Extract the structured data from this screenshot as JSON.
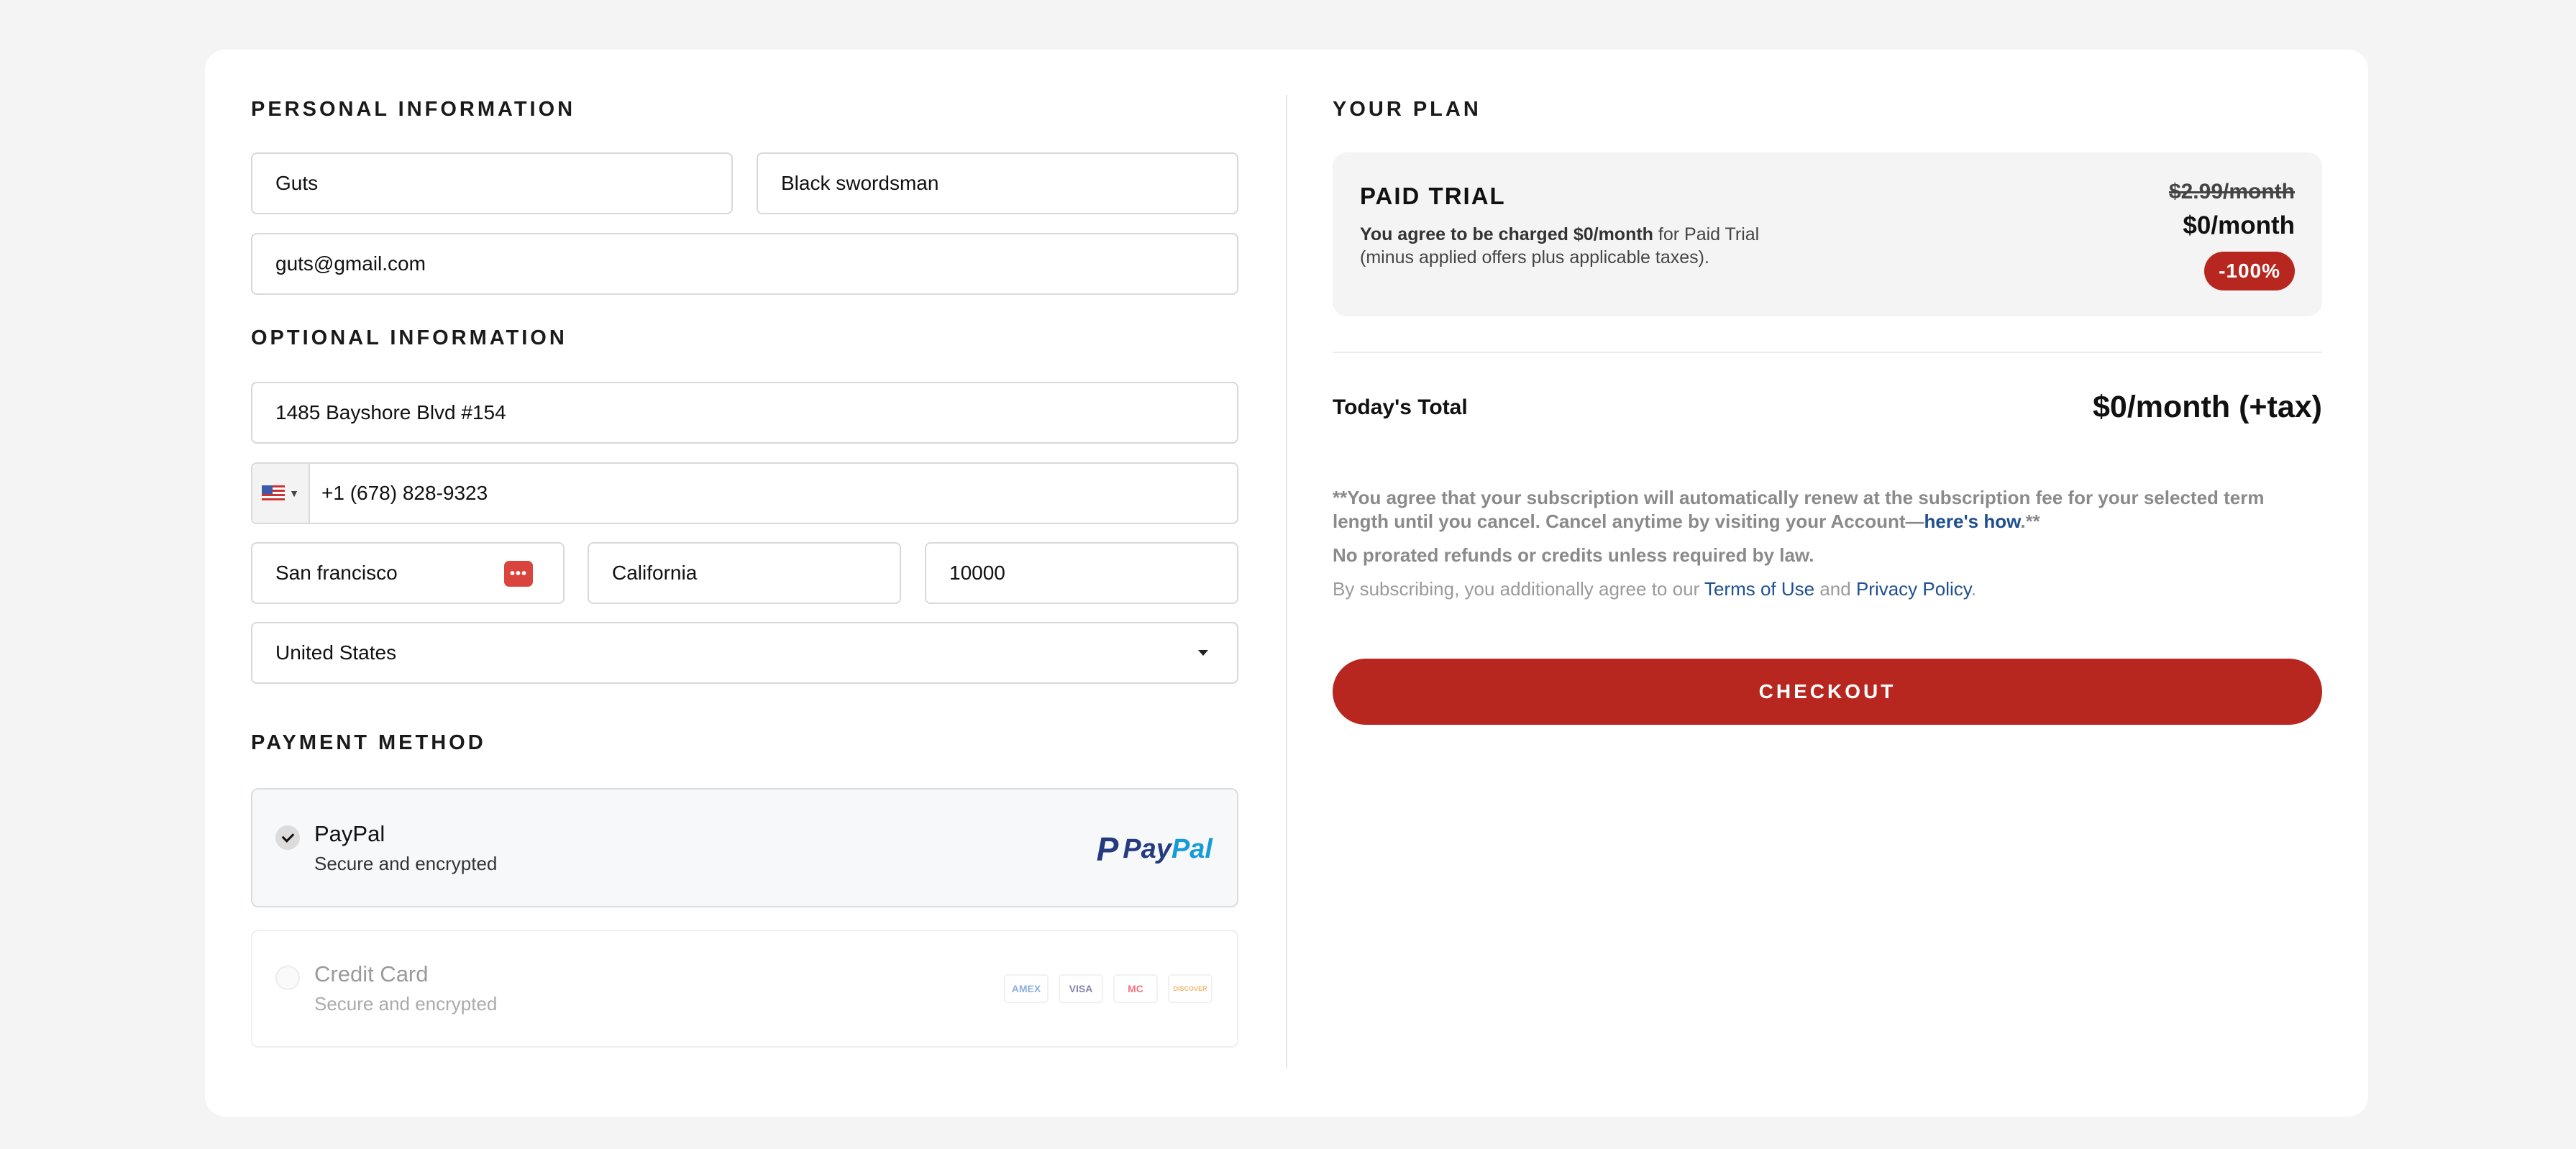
{
  "personal": {
    "title": "PERSONAL INFORMATION",
    "first_name": "Guts",
    "last_name": "Black swordsman",
    "email": "guts@gmail.com"
  },
  "optional": {
    "title": "OPTIONAL INFORMATION",
    "address": "1485 Bayshore Blvd #154",
    "phone": "+1 (678) 828-9323",
    "city": "San francisco",
    "state": "California",
    "zip": "10000",
    "country": "United States"
  },
  "payment": {
    "title": "PAYMENT METHOD",
    "options": [
      {
        "label": "PayPal",
        "sub": "Secure and encrypted",
        "selected": true,
        "logo_left": "Pay",
        "logo_right": "Pal"
      },
      {
        "label": "Credit Card",
        "sub": "Secure and encrypted",
        "selected": false,
        "cards": [
          "AMEX",
          "VISA",
          "MC",
          "DISCOVER"
        ]
      }
    ]
  },
  "plan": {
    "title": "YOUR PLAN",
    "name": "PAID TRIAL",
    "desc_bold": "You agree to be charged $0/month",
    "desc_rest": " for Paid Trial",
    "desc_line2": "(minus applied offers plus applicable taxes).",
    "old_price": "$2.99/month",
    "new_price": "$0/month",
    "discount": "-100%"
  },
  "total": {
    "label": "Today's Total",
    "value": "$0/month (+tax)"
  },
  "legal": {
    "renew_text": "**You agree that your subscription will automatically renew at the subscription fee for your selected term length until you cancel. Cancel anytime by visiting your Account—",
    "renew_link": "here's how",
    "renew_end": ".**",
    "refund": "No prorated refunds or credits unless required by law.",
    "agree_prefix": "By subscribing, you additionally agree to our ",
    "terms": "Terms of Use",
    "and": " and ",
    "privacy": "Privacy Policy",
    "period": "."
  },
  "checkout_label": "CHECKOUT",
  "colors": {
    "accent": "#b8271f",
    "link": "#1e4f8f",
    "paypal_dark": "#253b80",
    "paypal_light": "#179bd7"
  }
}
